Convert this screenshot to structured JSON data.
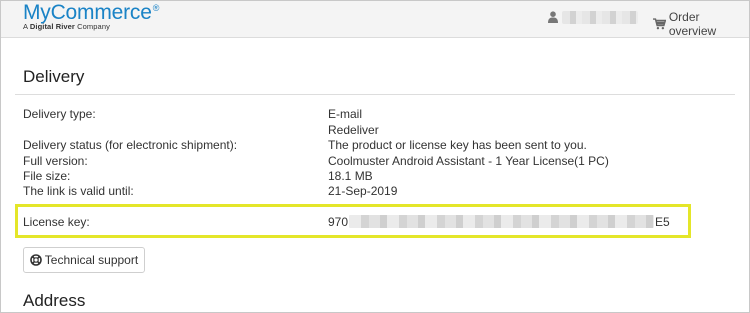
{
  "header": {
    "logo": "MyCommerce",
    "logo_mark": "®",
    "logo_subtitle_prefix": "A",
    "logo_subtitle_brand": "Digital River",
    "logo_subtitle_suffix": "Company",
    "user_icon": "user-icon",
    "user_name": "redacted",
    "order_overview": "Order overview",
    "cart_icon": "shopping-cart-icon"
  },
  "delivery": {
    "title": "Delivery",
    "rows": [
      {
        "label": "Delivery type:",
        "value": "E-mail"
      },
      {
        "label": "",
        "value": "Redeliver"
      },
      {
        "label": "Delivery status (for electronic shipment):",
        "value": "The product or license key has been sent to you."
      },
      {
        "label": "Full version:",
        "value": "Coolmuster Android Assistant - 1 Year License(1 PC)"
      },
      {
        "label": "File size:",
        "value": "18.1 MB"
      },
      {
        "label": "The link is valid until:",
        "value": "21-Sep-2019"
      }
    ],
    "license_key": {
      "label": "License key:",
      "prefix": "970",
      "suffix": "E5"
    },
    "support_button": "Technical support",
    "support_icon": "lifebuoy-icon",
    "highlight_color": "#e4e629"
  },
  "address": {
    "title": "Address"
  },
  "colors": {
    "brand": "#1a83c6",
    "link": "#1f74bb"
  }
}
